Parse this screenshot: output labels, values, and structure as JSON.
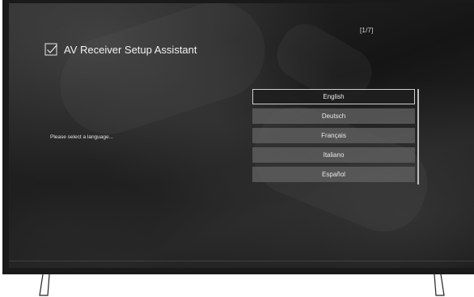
{
  "header": {
    "page_counter": "[1/7]",
    "title": "AV Receiver Setup Assistant",
    "title_icon": "checkbox-check-icon"
  },
  "prompt": {
    "text": "Please select a language..."
  },
  "languages": {
    "selected_index": 0,
    "items": [
      {
        "label": "English"
      },
      {
        "label": "Deutsch"
      },
      {
        "label": "Français"
      },
      {
        "label": "Italiano"
      },
      {
        "label": "Español"
      }
    ]
  },
  "colors": {
    "screen_background": "#1c1c1c",
    "item_background": "#5f5f5f",
    "selected_border": "#cfcfcf",
    "text": "#e8e8e8"
  }
}
